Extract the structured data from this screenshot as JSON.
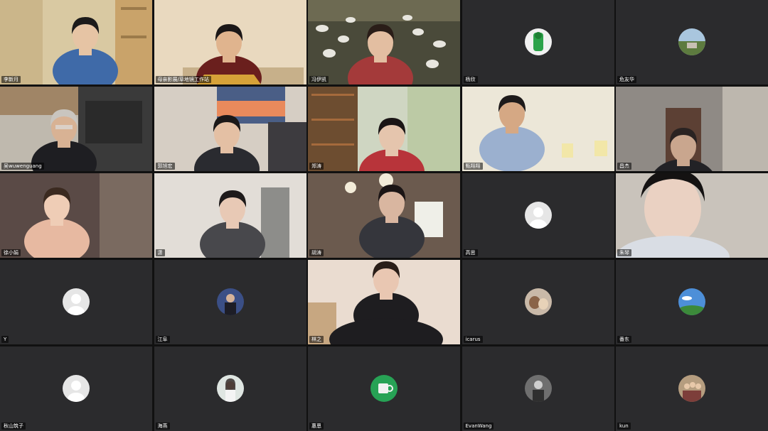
{
  "tiles": [
    {
      "name": "李新月",
      "kind": "video",
      "scene": "yellow-room"
    },
    {
      "name": "母亲影展/草地镜工作站",
      "kind": "video",
      "scene": "warm-room"
    },
    {
      "name": "冯伊凯",
      "kind": "video",
      "scene": "sheep-field",
      "active": true
    },
    {
      "name": "杨欣",
      "kind": "avatar",
      "avatar": "green-figure-avatar"
    },
    {
      "name": "危友华",
      "kind": "avatar",
      "avatar": "landscape-avatar"
    },
    {
      "name": "吴wuwenguang",
      "kind": "video",
      "scene": "kitchen-man"
    },
    {
      "name": "郭旭宏",
      "kind": "video",
      "scene": "sunset-window"
    },
    {
      "name": "郑涛",
      "kind": "video",
      "scene": "bookshelf"
    },
    {
      "name": "甄翔翔",
      "kind": "video",
      "scene": "bright-man"
    },
    {
      "name": "昌杰",
      "kind": "video",
      "scene": "dim-room"
    },
    {
      "name": "徐小娟",
      "kind": "video",
      "scene": "pink-jacket"
    },
    {
      "name": "潇",
      "kind": "video",
      "scene": "glasses-girl"
    },
    {
      "name": "胡涛",
      "kind": "video",
      "scene": "lamp-room"
    },
    {
      "name": "高思",
      "kind": "avatar",
      "avatar": "default-user-avatar"
    },
    {
      "name": "朱琴",
      "kind": "video",
      "scene": "close-face"
    },
    {
      "name": "Y",
      "kind": "avatar",
      "avatar": "default-user-avatar"
    },
    {
      "name": "江阜",
      "kind": "avatar",
      "avatar": "portrait-avatar"
    },
    {
      "name": "林之",
      "kind": "video",
      "scene": "dark-hoodie"
    },
    {
      "name": "icarus",
      "kind": "avatar",
      "avatar": "pet-avatar"
    },
    {
      "name": "番东",
      "kind": "avatar",
      "avatar": "sky-avatar"
    },
    {
      "name": "秋山筑子",
      "kind": "avatar",
      "avatar": "default-user-avatar"
    },
    {
      "name": "海燕",
      "kind": "avatar",
      "avatar": "woman-photo-avatar"
    },
    {
      "name": "惠恩",
      "kind": "avatar",
      "avatar": "mug-avatar"
    },
    {
      "name": "EvanWang",
      "kind": "avatar",
      "avatar": "monochrome-avatar"
    },
    {
      "name": "kun",
      "kind": "avatar",
      "avatar": "group-photo-avatar"
    }
  ],
  "colors": {
    "active_border": "#2fbf4f",
    "tile_bg": "#2b2b2d"
  }
}
